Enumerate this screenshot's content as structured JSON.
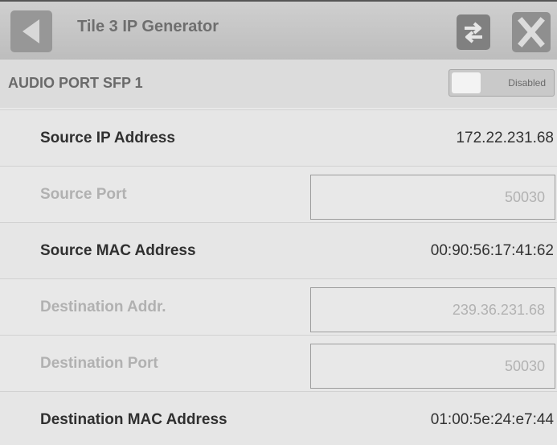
{
  "titlebar": {
    "title": "Tile 3 IP Generator"
  },
  "section": {
    "title": "AUDIO PORT SFP 1",
    "toggle_label": "Disabled"
  },
  "rows": [
    {
      "label": "Source IP Address",
      "value": "172.22.231.68"
    },
    {
      "label": "Source Port",
      "value": "50030"
    },
    {
      "label": "Source MAC Address",
      "value": "00:90:56:17:41:62"
    },
    {
      "label": "Destination Addr.",
      "value": "239.36.231.68"
    },
    {
      "label": "Destination Port",
      "value": "50030"
    },
    {
      "label": "Destination MAC Address",
      "value": "01:00:5e:24:e7:44"
    }
  ],
  "icons": {
    "back": "back-arrow-icon",
    "swap": "swap-arrows-icon",
    "close": "close-x-icon"
  },
  "colors": {
    "titlebar": "#c6c6c6",
    "panel": "#e8e8e8",
    "active_text": "#303030",
    "disabled_text": "#b1b1b1"
  }
}
